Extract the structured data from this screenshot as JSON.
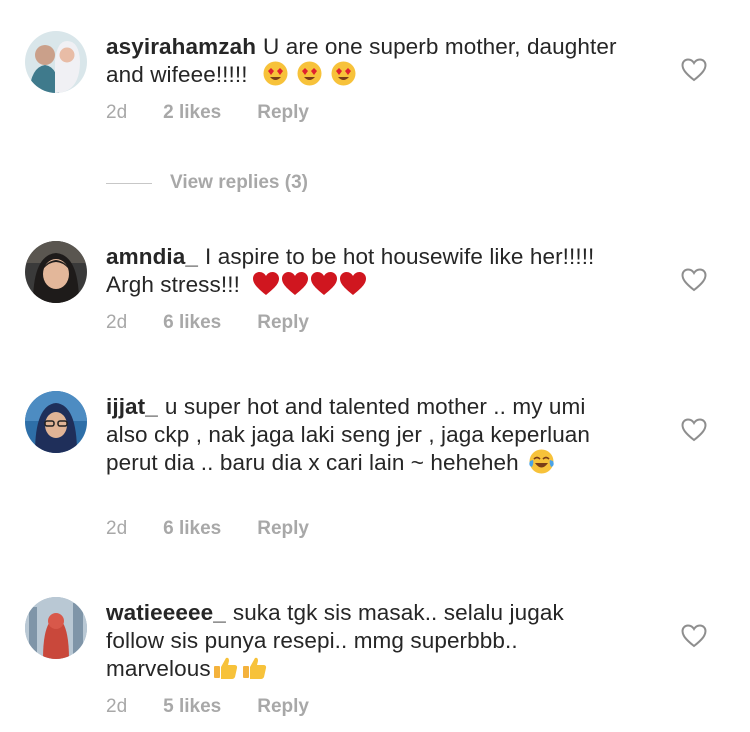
{
  "comments": [
    {
      "username": "asyirahamzah",
      "text": "U are one superb mother, daughter and wifeee!!!!!",
      "emoji": [
        "heart-eyes",
        "heart-eyes",
        "heart-eyes"
      ],
      "time": "2d",
      "likes": "2 likes",
      "reply": "Reply"
    },
    {
      "username": "amndia_",
      "text": "I aspire to be hot housewife like her!!!!! Argh stress!!!",
      "emoji": [
        "red-heart",
        "red-heart",
        "red-heart",
        "red-heart"
      ],
      "time": "2d",
      "likes": "6 likes",
      "reply": "Reply"
    },
    {
      "username": "ijjat_",
      "text": "u super hot and talented mother .. my umi also ckp , nak jaga laki seng jer , jaga keperluan perut dia .. baru dia x cari lain ~ heheheh",
      "emoji": [
        "tears-of-joy"
      ],
      "time": "2d",
      "likes": "6 likes",
      "reply": "Reply"
    },
    {
      "username": "watieeeee_",
      "text": "suka tgk sis masak.. selalu jugak follow sis punya resepi.. mmg superbbb.. marvelous",
      "emoji": [
        "thumbs-up",
        "thumbs-up"
      ],
      "time": "2d",
      "likes": "5 likes",
      "reply": "Reply"
    }
  ],
  "view_replies": "View replies (3)",
  "icons": {
    "like": "heart-outline-icon"
  },
  "colors": {
    "text": "#262626",
    "meta": "#a8a8a8",
    "heart": "#e0212e"
  }
}
